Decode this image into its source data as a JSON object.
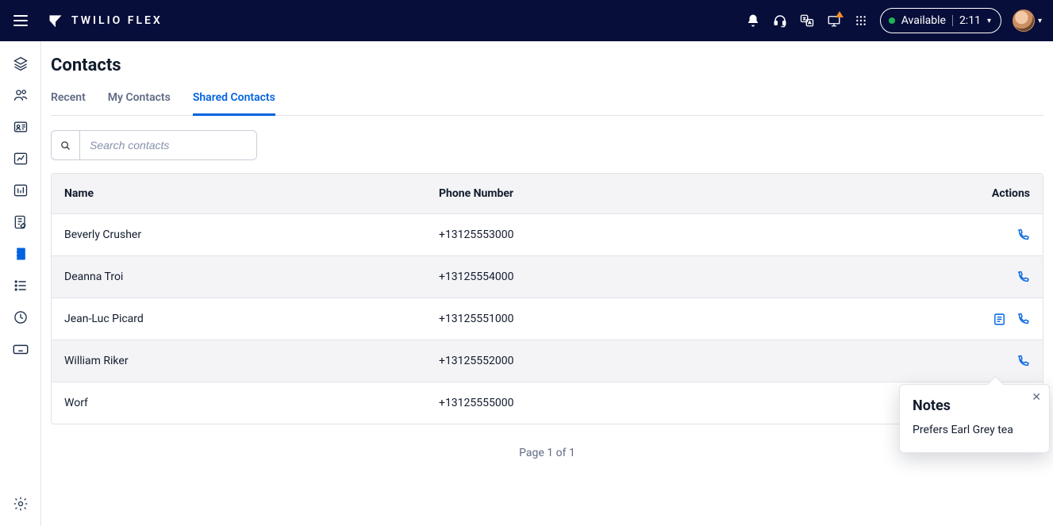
{
  "app": {
    "brand": "TWILIO FLEX"
  },
  "header": {
    "status_label": "Available",
    "timer": "2:11"
  },
  "page": {
    "title": "Contacts",
    "pager": "Page 1 of 1"
  },
  "tabs": [
    {
      "id": "recent",
      "label": "Recent",
      "active": false
    },
    {
      "id": "my-contacts",
      "label": "My Contacts",
      "active": false
    },
    {
      "id": "shared-contacts",
      "label": "Shared Contacts",
      "active": true
    }
  ],
  "search": {
    "placeholder": "Search contacts",
    "value": ""
  },
  "table": {
    "columns": {
      "name": "Name",
      "phone": "Phone Number",
      "actions": "Actions"
    },
    "rows": [
      {
        "name": "Beverly Crusher",
        "phone": "+13125553000",
        "has_notes": false
      },
      {
        "name": "Deanna Troi",
        "phone": "+13125554000",
        "has_notes": false
      },
      {
        "name": "Jean-Luc Picard",
        "phone": "+13125551000",
        "has_notes": true
      },
      {
        "name": "William Riker",
        "phone": "+13125552000",
        "has_notes": false
      },
      {
        "name": "Worf",
        "phone": "+13125555000",
        "has_notes": false
      }
    ]
  },
  "popover": {
    "title": "Notes",
    "body": "Prefers Earl Grey tea"
  }
}
